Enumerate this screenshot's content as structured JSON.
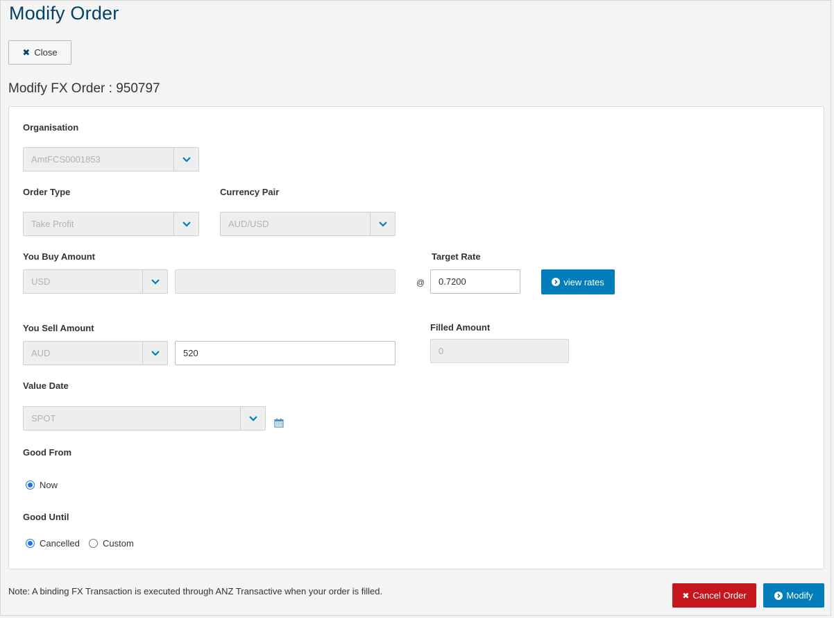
{
  "page": {
    "title": "Modify Order",
    "close_label": "Close",
    "subtitle": "Modify FX Order : 950797"
  },
  "form": {
    "organisation": {
      "label": "Organisation",
      "value": "AmtFCS0001853"
    },
    "order_type": {
      "label": "Order Type",
      "value": "Take Profit"
    },
    "currency_pair": {
      "label": "Currency Pair",
      "value": "AUD/USD"
    },
    "buy": {
      "label": "You Buy Amount",
      "currency": "USD",
      "amount": ""
    },
    "at_symbol": "@",
    "target_rate": {
      "label": "Target Rate",
      "value": "0.7200"
    },
    "view_rates_label": "view rates",
    "sell": {
      "label": "You Sell Amount",
      "currency": "AUD",
      "amount": "520"
    },
    "filled_amount": {
      "label": "Filled Amount",
      "value": "0"
    },
    "value_date": {
      "label": "Value Date",
      "value": "SPOT"
    },
    "good_from": {
      "label": "Good From",
      "options": [
        "Now"
      ],
      "selected": "Now"
    },
    "good_until": {
      "label": "Good Until",
      "options": [
        "Cancelled",
        "Custom"
      ],
      "selected": "Cancelled"
    }
  },
  "footer": {
    "note": "Note: A binding FX Transaction is executed through ANZ Transactive when your order is filled.",
    "cancel_label": "Cancel Order",
    "modify_label": "Modify"
  },
  "colors": {
    "brand_blue": "#004165",
    "primary": "#007dba",
    "danger": "#c4161c"
  },
  "icons": [
    "close-icon",
    "chevron-down-icon",
    "circle-chevron-right-icon",
    "calendar-icon"
  ]
}
